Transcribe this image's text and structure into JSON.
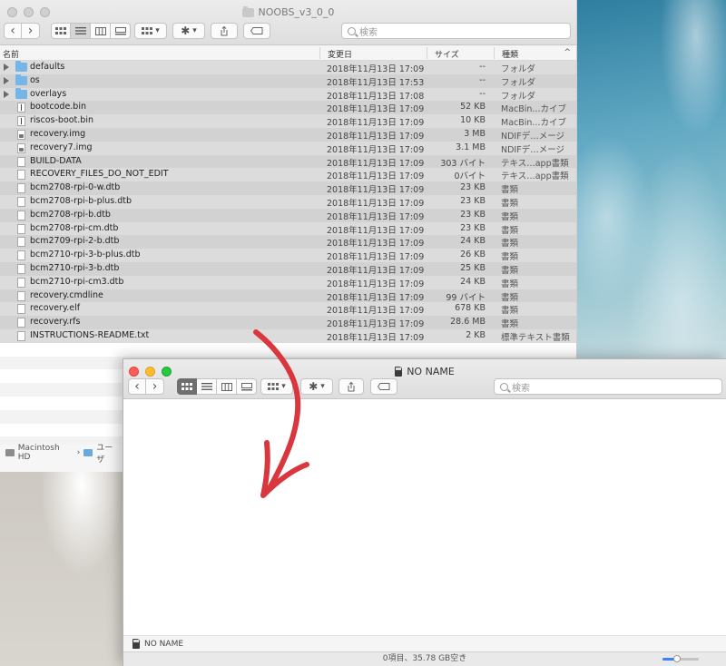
{
  "colors": {
    "accent": "#3b82f6",
    "folder": "#74b6e8",
    "annotation_arrow": "#d9363e"
  },
  "back_window": {
    "title": "NOOBS_v3_0_0",
    "search_placeholder": "検索",
    "columns": {
      "name": "名前",
      "date": "変更日",
      "size": "サイズ",
      "kind": "種類"
    },
    "files": [
      {
        "name": "defaults",
        "date": "2018年11月13日 17:09",
        "size": "--",
        "kind": "フォルダ",
        "type": "folder"
      },
      {
        "name": "os",
        "date": "2018年11月13日 17:53",
        "size": "--",
        "kind": "フォルダ",
        "type": "folder"
      },
      {
        "name": "overlays",
        "date": "2018年11月13日 17:08",
        "size": "--",
        "kind": "フォルダ",
        "type": "folder"
      },
      {
        "name": "bootcode.bin",
        "date": "2018年11月13日 17:09",
        "size": "52 KB",
        "kind": "MacBin...カイブ",
        "type": "exec"
      },
      {
        "name": "riscos-boot.bin",
        "date": "2018年11月13日 17:09",
        "size": "10 KB",
        "kind": "MacBin...カイブ",
        "type": "exec"
      },
      {
        "name": "recovery.img",
        "date": "2018年11月13日 17:09",
        "size": "3 MB",
        "kind": "NDIFデ…メージ",
        "type": "disk"
      },
      {
        "name": "recovery7.img",
        "date": "2018年11月13日 17:09",
        "size": "3.1 MB",
        "kind": "NDIFデ…メージ",
        "type": "disk"
      },
      {
        "name": "BUILD-DATA",
        "date": "2018年11月13日 17:09",
        "size": "303 バイト",
        "kind": "テキス…app書類",
        "type": "file"
      },
      {
        "name": "RECOVERY_FILES_DO_NOT_EDIT",
        "date": "2018年11月13日 17:09",
        "size": "0バイト",
        "kind": "テキス…app書類",
        "type": "file"
      },
      {
        "name": "bcm2708-rpi-0-w.dtb",
        "date": "2018年11月13日 17:09",
        "size": "23 KB",
        "kind": "書類",
        "type": "file"
      },
      {
        "name": "bcm2708-rpi-b-plus.dtb",
        "date": "2018年11月13日 17:09",
        "size": "23 KB",
        "kind": "書類",
        "type": "file"
      },
      {
        "name": "bcm2708-rpi-b.dtb",
        "date": "2018年11月13日 17:09",
        "size": "23 KB",
        "kind": "書類",
        "type": "file"
      },
      {
        "name": "bcm2708-rpi-cm.dtb",
        "date": "2018年11月13日 17:09",
        "size": "23 KB",
        "kind": "書類",
        "type": "file"
      },
      {
        "name": "bcm2709-rpi-2-b.dtb",
        "date": "2018年11月13日 17:09",
        "size": "24 KB",
        "kind": "書類",
        "type": "file"
      },
      {
        "name": "bcm2710-rpi-3-b-plus.dtb",
        "date": "2018年11月13日 17:09",
        "size": "26 KB",
        "kind": "書類",
        "type": "file"
      },
      {
        "name": "bcm2710-rpi-3-b.dtb",
        "date": "2018年11月13日 17:09",
        "size": "25 KB",
        "kind": "書類",
        "type": "file"
      },
      {
        "name": "bcm2710-rpi-cm3.dtb",
        "date": "2018年11月13日 17:09",
        "size": "24 KB",
        "kind": "書類",
        "type": "file"
      },
      {
        "name": "recovery.cmdline",
        "date": "2018年11月13日 17:09",
        "size": "99 バイト",
        "kind": "書類",
        "type": "file"
      },
      {
        "name": "recovery.elf",
        "date": "2018年11月13日 17:09",
        "size": "678 KB",
        "kind": "書類",
        "type": "file"
      },
      {
        "name": "recovery.rfs",
        "date": "2018年11月13日 17:09",
        "size": "28.6 MB",
        "kind": "書類",
        "type": "file"
      },
      {
        "name": "INSTRUCTIONS-README.txt",
        "date": "2018年11月13日 17:09",
        "size": "2 KB",
        "kind": "標準テキスト書類",
        "type": "file"
      }
    ],
    "path": {
      "disk": "Macintosh HD",
      "user": "ユーザ"
    }
  },
  "front_window": {
    "title": "NO NAME",
    "search_placeholder": "検索",
    "path_label": "NO NAME",
    "status": "0項目、35.78 GB空き"
  },
  "icons": {
    "back": "‹",
    "forward": "›",
    "chevron": "▾",
    "sort_up": "^",
    "separator": "›",
    "gear": "✱"
  }
}
